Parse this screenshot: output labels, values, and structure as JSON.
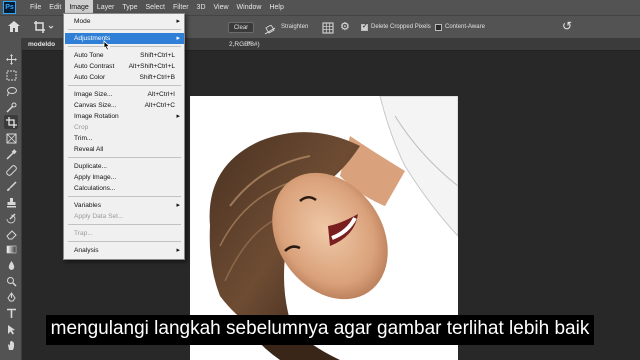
{
  "menubar": {
    "items": [
      "File",
      "Edit",
      "Image",
      "Layer",
      "Type",
      "Select",
      "Filter",
      "3D",
      "View",
      "Window",
      "Help"
    ],
    "active": "Image"
  },
  "optionsbar": {
    "clear_label": "Clear",
    "straighten_label": "Straighten",
    "delete_cropped_label": "Delete Cropped Pixels",
    "delete_cropped_checked": true,
    "content_aware_label": "Content-Aware",
    "content_aware_checked": false
  },
  "document_tab": {
    "name": "modeldo",
    "suffix": "2,RGB/8#)",
    "close": "×"
  },
  "image_menu": {
    "items": [
      {
        "label": "Mode",
        "shortcut": "",
        "submenu": true,
        "disabled": false,
        "highlighted": false
      },
      {
        "label": "Adjustments",
        "shortcut": "",
        "submenu": true,
        "disabled": false,
        "highlighted": true
      },
      {
        "label": "Auto Tone",
        "shortcut": "Shift+Ctrl+L",
        "submenu": false,
        "disabled": false,
        "highlighted": false
      },
      {
        "label": "Auto Contrast",
        "shortcut": "Alt+Shift+Ctrl+L",
        "submenu": false,
        "disabled": false,
        "highlighted": false
      },
      {
        "label": "Auto Color",
        "shortcut": "Shift+Ctrl+B",
        "submenu": false,
        "disabled": false,
        "highlighted": false
      },
      {
        "label": "Image Size...",
        "shortcut": "Alt+Ctrl+I",
        "submenu": false,
        "disabled": false,
        "highlighted": false
      },
      {
        "label": "Canvas Size...",
        "shortcut": "Alt+Ctrl+C",
        "submenu": false,
        "disabled": false,
        "highlighted": false
      },
      {
        "label": "Image Rotation",
        "shortcut": "",
        "submenu": true,
        "disabled": false,
        "highlighted": false
      },
      {
        "label": "Crop",
        "shortcut": "",
        "submenu": false,
        "disabled": true,
        "highlighted": false
      },
      {
        "label": "Trim...",
        "shortcut": "",
        "submenu": false,
        "disabled": false,
        "highlighted": false
      },
      {
        "label": "Reveal All",
        "shortcut": "",
        "submenu": false,
        "disabled": false,
        "highlighted": false
      },
      {
        "label": "Duplicate...",
        "shortcut": "",
        "submenu": false,
        "disabled": false,
        "highlighted": false
      },
      {
        "label": "Apply Image...",
        "shortcut": "",
        "submenu": false,
        "disabled": false,
        "highlighted": false
      },
      {
        "label": "Calculations...",
        "shortcut": "",
        "submenu": false,
        "disabled": false,
        "highlighted": false
      },
      {
        "label": "Variables",
        "shortcut": "",
        "submenu": true,
        "disabled": false,
        "highlighted": false
      },
      {
        "label": "Apply Data Set...",
        "shortcut": "",
        "submenu": false,
        "disabled": true,
        "highlighted": false
      },
      {
        "label": "Trap...",
        "shortcut": "",
        "submenu": false,
        "disabled": true,
        "highlighted": false
      },
      {
        "label": "Analysis",
        "shortcut": "",
        "submenu": true,
        "disabled": false,
        "highlighted": false
      }
    ]
  },
  "subtitle": "mengulangi langkah sebelumnya agar gambar terlihat lebih baik",
  "colors": {
    "menubar_bg": "#535353",
    "canvas_bg": "#282828",
    "menu_bg": "#f0f0f0",
    "highlight": "#2f7fd6",
    "ps_blue": "#31a8ff"
  },
  "icons": {
    "home": "home-icon",
    "crop": "crop-icon",
    "straighten": "straighten-icon",
    "grid": "grid-overlay-icon",
    "settings": "gear-icon",
    "reset": "reset-icon",
    "cursor": "mouse-cursor-icon"
  }
}
